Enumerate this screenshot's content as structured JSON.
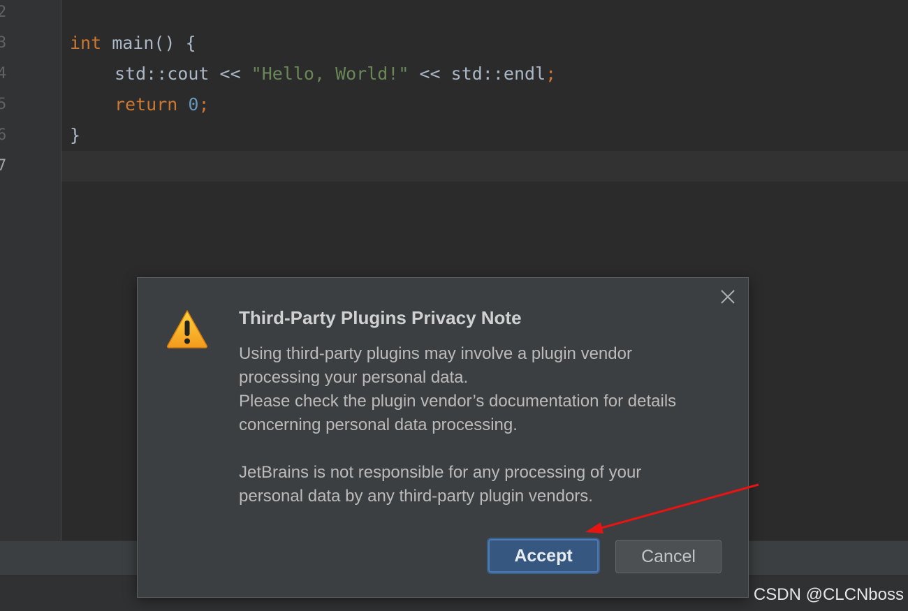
{
  "editor": {
    "line_numbers": [
      "2",
      "3",
      "4",
      "5",
      "6",
      "7"
    ],
    "code": {
      "line3": {
        "kw": "int",
        "rest": " main() {"
      },
      "line4": {
        "a": "std::cout << ",
        "str": "\"Hello, World!\"",
        "b": " << std::endl",
        "semi": ";"
      },
      "line5": {
        "kw": "return",
        "num": "0",
        "semi": ";"
      },
      "line6": {
        "text": "}"
      }
    }
  },
  "dialog": {
    "title": "Third-Party Plugins Privacy Note",
    "body_lines_1": [
      "Using third-party plugins may involve a plugin vendor",
      "processing your personal data.",
      "Please check the plugin vendor’s documentation for details",
      "concerning personal data processing."
    ],
    "body_lines_2": [
      "JetBrains is not responsible for any processing of your",
      "personal data by any third-party plugin vendors."
    ],
    "accept_label": "Accept",
    "cancel_label": "Cancel"
  },
  "icons": {
    "close": "close-icon",
    "warning": "warning-icon"
  },
  "colors": {
    "editor_bg": "#2b2b2b",
    "keyword": "#cc7832",
    "string": "#6a8759",
    "number": "#6897bb",
    "accept_bg": "#365880",
    "annotation_arrow": "#e81414"
  },
  "watermark": "CSDN @CLCNboss"
}
